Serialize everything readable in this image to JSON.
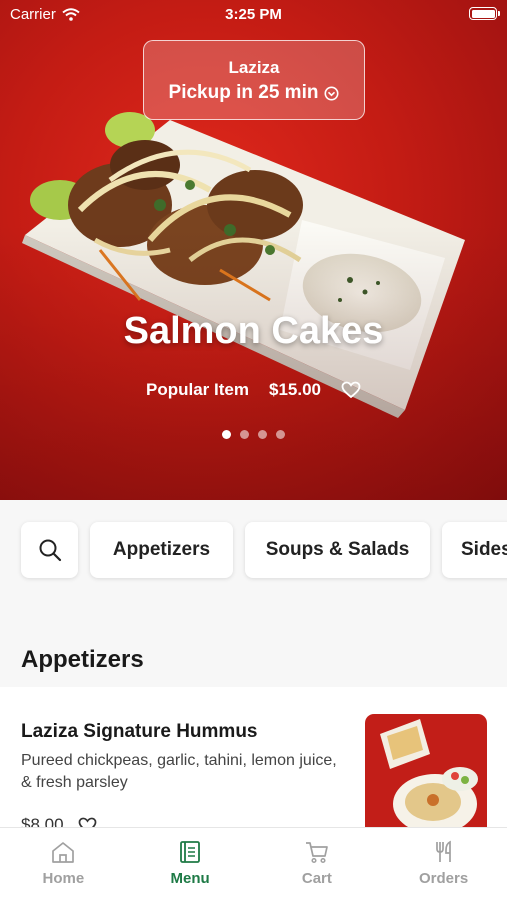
{
  "status_bar": {
    "carrier": "Carrier",
    "time": "3:25 PM"
  },
  "pickup": {
    "restaurant": "Laziza",
    "pickup_time": "Pickup in 25 min"
  },
  "featured": {
    "title": "Salmon Cakes",
    "tag": "Popular Item",
    "price": "$15.00",
    "slide_count": 4,
    "active_slide": 1
  },
  "categories": {
    "items": [
      "Appetizers",
      "Soups & Salads",
      "Sides"
    ]
  },
  "section": {
    "title": "Appetizers"
  },
  "menu_item": {
    "name": "Laziza Signature Hummus",
    "description": "Pureed chickpeas, garlic, tahini, lemon juice, & fresh parsley",
    "price": "$8.00"
  },
  "tab_bar": {
    "tabs": [
      {
        "label": "Home",
        "icon": "home-icon"
      },
      {
        "label": "Menu",
        "icon": "menu-book-icon"
      },
      {
        "label": "Cart",
        "icon": "cart-icon"
      },
      {
        "label": "Orders",
        "icon": "fork-knife-icon"
      }
    ],
    "active": "Menu"
  },
  "colors": {
    "accent": "#1e7a46",
    "hero_red": "#c41c14"
  }
}
